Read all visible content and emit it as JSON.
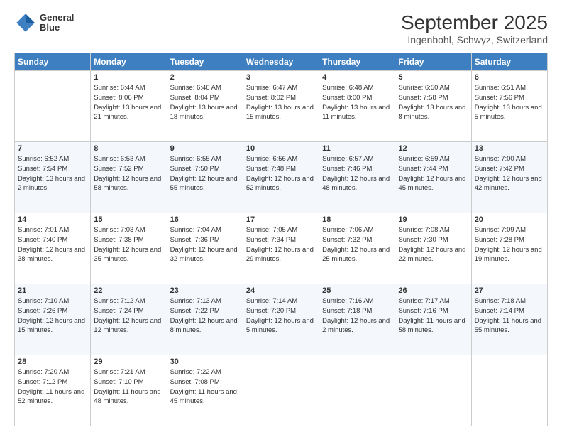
{
  "header": {
    "logo_line1": "General",
    "logo_line2": "Blue",
    "title": "September 2025",
    "subtitle": "Ingenbohl, Schwyz, Switzerland"
  },
  "days_of_week": [
    "Sunday",
    "Monday",
    "Tuesday",
    "Wednesday",
    "Thursday",
    "Friday",
    "Saturday"
  ],
  "weeks": [
    [
      {
        "day": "",
        "sunrise": "",
        "sunset": "",
        "daylight": ""
      },
      {
        "day": "1",
        "sunrise": "Sunrise: 6:44 AM",
        "sunset": "Sunset: 8:06 PM",
        "daylight": "Daylight: 13 hours and 21 minutes."
      },
      {
        "day": "2",
        "sunrise": "Sunrise: 6:46 AM",
        "sunset": "Sunset: 8:04 PM",
        "daylight": "Daylight: 13 hours and 18 minutes."
      },
      {
        "day": "3",
        "sunrise": "Sunrise: 6:47 AM",
        "sunset": "Sunset: 8:02 PM",
        "daylight": "Daylight: 13 hours and 15 minutes."
      },
      {
        "day": "4",
        "sunrise": "Sunrise: 6:48 AM",
        "sunset": "Sunset: 8:00 PM",
        "daylight": "Daylight: 13 hours and 11 minutes."
      },
      {
        "day": "5",
        "sunrise": "Sunrise: 6:50 AM",
        "sunset": "Sunset: 7:58 PM",
        "daylight": "Daylight: 13 hours and 8 minutes."
      },
      {
        "day": "6",
        "sunrise": "Sunrise: 6:51 AM",
        "sunset": "Sunset: 7:56 PM",
        "daylight": "Daylight: 13 hours and 5 minutes."
      }
    ],
    [
      {
        "day": "7",
        "sunrise": "Sunrise: 6:52 AM",
        "sunset": "Sunset: 7:54 PM",
        "daylight": "Daylight: 13 hours and 2 minutes."
      },
      {
        "day": "8",
        "sunrise": "Sunrise: 6:53 AM",
        "sunset": "Sunset: 7:52 PM",
        "daylight": "Daylight: 12 hours and 58 minutes."
      },
      {
        "day": "9",
        "sunrise": "Sunrise: 6:55 AM",
        "sunset": "Sunset: 7:50 PM",
        "daylight": "Daylight: 12 hours and 55 minutes."
      },
      {
        "day": "10",
        "sunrise": "Sunrise: 6:56 AM",
        "sunset": "Sunset: 7:48 PM",
        "daylight": "Daylight: 12 hours and 52 minutes."
      },
      {
        "day": "11",
        "sunrise": "Sunrise: 6:57 AM",
        "sunset": "Sunset: 7:46 PM",
        "daylight": "Daylight: 12 hours and 48 minutes."
      },
      {
        "day": "12",
        "sunrise": "Sunrise: 6:59 AM",
        "sunset": "Sunset: 7:44 PM",
        "daylight": "Daylight: 12 hours and 45 minutes."
      },
      {
        "day": "13",
        "sunrise": "Sunrise: 7:00 AM",
        "sunset": "Sunset: 7:42 PM",
        "daylight": "Daylight: 12 hours and 42 minutes."
      }
    ],
    [
      {
        "day": "14",
        "sunrise": "Sunrise: 7:01 AM",
        "sunset": "Sunset: 7:40 PM",
        "daylight": "Daylight: 12 hours and 38 minutes."
      },
      {
        "day": "15",
        "sunrise": "Sunrise: 7:03 AM",
        "sunset": "Sunset: 7:38 PM",
        "daylight": "Daylight: 12 hours and 35 minutes."
      },
      {
        "day": "16",
        "sunrise": "Sunrise: 7:04 AM",
        "sunset": "Sunset: 7:36 PM",
        "daylight": "Daylight: 12 hours and 32 minutes."
      },
      {
        "day": "17",
        "sunrise": "Sunrise: 7:05 AM",
        "sunset": "Sunset: 7:34 PM",
        "daylight": "Daylight: 12 hours and 29 minutes."
      },
      {
        "day": "18",
        "sunrise": "Sunrise: 7:06 AM",
        "sunset": "Sunset: 7:32 PM",
        "daylight": "Daylight: 12 hours and 25 minutes."
      },
      {
        "day": "19",
        "sunrise": "Sunrise: 7:08 AM",
        "sunset": "Sunset: 7:30 PM",
        "daylight": "Daylight: 12 hours and 22 minutes."
      },
      {
        "day": "20",
        "sunrise": "Sunrise: 7:09 AM",
        "sunset": "Sunset: 7:28 PM",
        "daylight": "Daylight: 12 hours and 19 minutes."
      }
    ],
    [
      {
        "day": "21",
        "sunrise": "Sunrise: 7:10 AM",
        "sunset": "Sunset: 7:26 PM",
        "daylight": "Daylight: 12 hours and 15 minutes."
      },
      {
        "day": "22",
        "sunrise": "Sunrise: 7:12 AM",
        "sunset": "Sunset: 7:24 PM",
        "daylight": "Daylight: 12 hours and 12 minutes."
      },
      {
        "day": "23",
        "sunrise": "Sunrise: 7:13 AM",
        "sunset": "Sunset: 7:22 PM",
        "daylight": "Daylight: 12 hours and 8 minutes."
      },
      {
        "day": "24",
        "sunrise": "Sunrise: 7:14 AM",
        "sunset": "Sunset: 7:20 PM",
        "daylight": "Daylight: 12 hours and 5 minutes."
      },
      {
        "day": "25",
        "sunrise": "Sunrise: 7:16 AM",
        "sunset": "Sunset: 7:18 PM",
        "daylight": "Daylight: 12 hours and 2 minutes."
      },
      {
        "day": "26",
        "sunrise": "Sunrise: 7:17 AM",
        "sunset": "Sunset: 7:16 PM",
        "daylight": "Daylight: 11 hours and 58 minutes."
      },
      {
        "day": "27",
        "sunrise": "Sunrise: 7:18 AM",
        "sunset": "Sunset: 7:14 PM",
        "daylight": "Daylight: 11 hours and 55 minutes."
      }
    ],
    [
      {
        "day": "28",
        "sunrise": "Sunrise: 7:20 AM",
        "sunset": "Sunset: 7:12 PM",
        "daylight": "Daylight: 11 hours and 52 minutes."
      },
      {
        "day": "29",
        "sunrise": "Sunrise: 7:21 AM",
        "sunset": "Sunset: 7:10 PM",
        "daylight": "Daylight: 11 hours and 48 minutes."
      },
      {
        "day": "30",
        "sunrise": "Sunrise: 7:22 AM",
        "sunset": "Sunset: 7:08 PM",
        "daylight": "Daylight: 11 hours and 45 minutes."
      },
      {
        "day": "",
        "sunrise": "",
        "sunset": "",
        "daylight": ""
      },
      {
        "day": "",
        "sunrise": "",
        "sunset": "",
        "daylight": ""
      },
      {
        "day": "",
        "sunrise": "",
        "sunset": "",
        "daylight": ""
      },
      {
        "day": "",
        "sunrise": "",
        "sunset": "",
        "daylight": ""
      }
    ]
  ]
}
